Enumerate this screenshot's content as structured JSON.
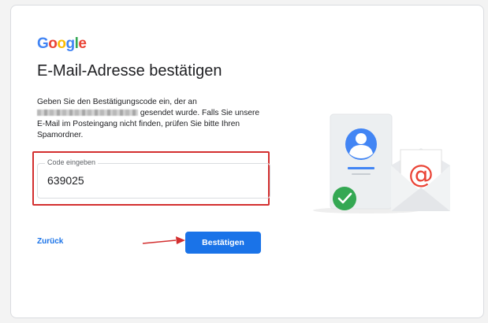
{
  "logo": {
    "letters": [
      "G",
      "o",
      "o",
      "g",
      "l",
      "e"
    ],
    "colors": [
      "#4285f4",
      "#ea4335",
      "#fbbc05",
      "#4285f4",
      "#34a853",
      "#ea4335"
    ]
  },
  "page": {
    "title": "E-Mail-Adresse bestätigen",
    "description_start": "Geben Sie den Bestätigungscode ein, der an",
    "description_end": "gesendet wurde. Falls Sie unsere E-Mail im Posteingang nicht finden, prüfen Sie bitte Ihren Spamordner."
  },
  "code_field": {
    "label": "Code eingeben",
    "value": "639025"
  },
  "actions": {
    "back_label": "Zurück",
    "confirm_label": "Bestätigen"
  },
  "colors": {
    "accent": "#1a73e8",
    "highlight": "#d32f2f",
    "success": "#34a853",
    "mail_symbol": "#ea4335"
  },
  "icons": {
    "illustration": [
      "contact-card-icon",
      "check-circle-icon",
      "envelope-at-icon"
    ],
    "annotation": "red-arrow-icon"
  }
}
